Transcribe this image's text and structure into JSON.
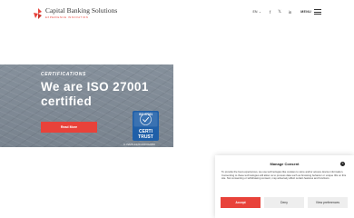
{
  "header": {
    "brand_name": "Capital Banking Solutions",
    "brand_tagline": "EXPERIENCE INNOVATION",
    "language": "EN",
    "social": [
      "f",
      "𝕏",
      "in"
    ],
    "menu_label": "MENU"
  },
  "banner": {
    "eyebrow": "CERTIFICATIONS",
    "headline": "We are ISO 27001 certified",
    "cta_label": "Read More",
    "badge_top": "ISO 27001",
    "badge_bottom_1": "CERTI",
    "badge_bottom_2": "TRUST",
    "cert_code": "C-ISMS-0120-ROC02050"
  },
  "consent": {
    "title": "Manage Consent",
    "close": "×",
    "text": "To provide the best experiences, we use technologies like cookies to store and/or access device information. Consenting to these technologies will allow us to process data such as browsing behavior or unique IDs on this site. Not consenting or withdrawing consent, may adversely affect certain features and functions.",
    "accept_label": "Accept",
    "deny_label": "Deny",
    "prefs_label": "View preferences"
  },
  "colors": {
    "accent": "#e8423a",
    "banner_bg": "#7f8a96",
    "badge_blue": "#1f5fa8"
  }
}
